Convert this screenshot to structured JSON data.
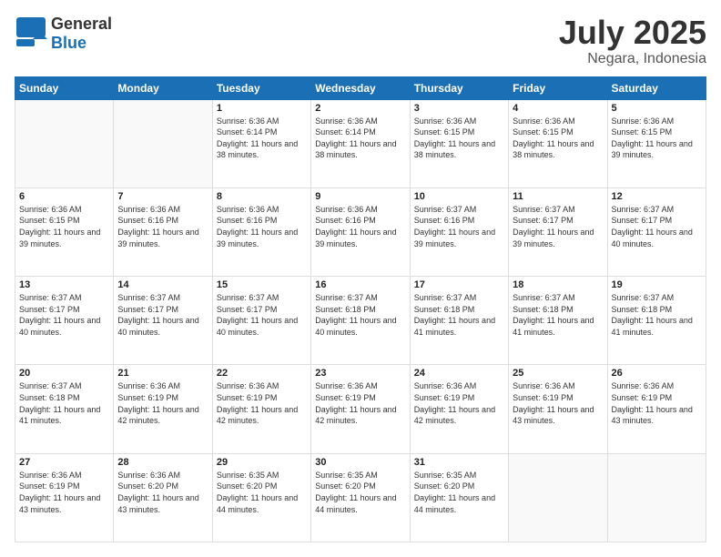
{
  "logo": {
    "general": "General",
    "blue": "Blue"
  },
  "header": {
    "title": "July 2025",
    "subtitle": "Negara, Indonesia"
  },
  "days_of_week": [
    "Sunday",
    "Monday",
    "Tuesday",
    "Wednesday",
    "Thursday",
    "Friday",
    "Saturday"
  ],
  "weeks": [
    [
      {
        "day": "",
        "info": ""
      },
      {
        "day": "",
        "info": ""
      },
      {
        "day": "1",
        "info": "Sunrise: 6:36 AM\nSunset: 6:14 PM\nDaylight: 11 hours and 38 minutes."
      },
      {
        "day": "2",
        "info": "Sunrise: 6:36 AM\nSunset: 6:14 PM\nDaylight: 11 hours and 38 minutes."
      },
      {
        "day": "3",
        "info": "Sunrise: 6:36 AM\nSunset: 6:15 PM\nDaylight: 11 hours and 38 minutes."
      },
      {
        "day": "4",
        "info": "Sunrise: 6:36 AM\nSunset: 6:15 PM\nDaylight: 11 hours and 38 minutes."
      },
      {
        "day": "5",
        "info": "Sunrise: 6:36 AM\nSunset: 6:15 PM\nDaylight: 11 hours and 39 minutes."
      }
    ],
    [
      {
        "day": "6",
        "info": "Sunrise: 6:36 AM\nSunset: 6:15 PM\nDaylight: 11 hours and 39 minutes."
      },
      {
        "day": "7",
        "info": "Sunrise: 6:36 AM\nSunset: 6:16 PM\nDaylight: 11 hours and 39 minutes."
      },
      {
        "day": "8",
        "info": "Sunrise: 6:36 AM\nSunset: 6:16 PM\nDaylight: 11 hours and 39 minutes."
      },
      {
        "day": "9",
        "info": "Sunrise: 6:36 AM\nSunset: 6:16 PM\nDaylight: 11 hours and 39 minutes."
      },
      {
        "day": "10",
        "info": "Sunrise: 6:37 AM\nSunset: 6:16 PM\nDaylight: 11 hours and 39 minutes."
      },
      {
        "day": "11",
        "info": "Sunrise: 6:37 AM\nSunset: 6:17 PM\nDaylight: 11 hours and 39 minutes."
      },
      {
        "day": "12",
        "info": "Sunrise: 6:37 AM\nSunset: 6:17 PM\nDaylight: 11 hours and 40 minutes."
      }
    ],
    [
      {
        "day": "13",
        "info": "Sunrise: 6:37 AM\nSunset: 6:17 PM\nDaylight: 11 hours and 40 minutes."
      },
      {
        "day": "14",
        "info": "Sunrise: 6:37 AM\nSunset: 6:17 PM\nDaylight: 11 hours and 40 minutes."
      },
      {
        "day": "15",
        "info": "Sunrise: 6:37 AM\nSunset: 6:17 PM\nDaylight: 11 hours and 40 minutes."
      },
      {
        "day": "16",
        "info": "Sunrise: 6:37 AM\nSunset: 6:18 PM\nDaylight: 11 hours and 40 minutes."
      },
      {
        "day": "17",
        "info": "Sunrise: 6:37 AM\nSunset: 6:18 PM\nDaylight: 11 hours and 41 minutes."
      },
      {
        "day": "18",
        "info": "Sunrise: 6:37 AM\nSunset: 6:18 PM\nDaylight: 11 hours and 41 minutes."
      },
      {
        "day": "19",
        "info": "Sunrise: 6:37 AM\nSunset: 6:18 PM\nDaylight: 11 hours and 41 minutes."
      }
    ],
    [
      {
        "day": "20",
        "info": "Sunrise: 6:37 AM\nSunset: 6:18 PM\nDaylight: 11 hours and 41 minutes."
      },
      {
        "day": "21",
        "info": "Sunrise: 6:36 AM\nSunset: 6:19 PM\nDaylight: 11 hours and 42 minutes."
      },
      {
        "day": "22",
        "info": "Sunrise: 6:36 AM\nSunset: 6:19 PM\nDaylight: 11 hours and 42 minutes."
      },
      {
        "day": "23",
        "info": "Sunrise: 6:36 AM\nSunset: 6:19 PM\nDaylight: 11 hours and 42 minutes."
      },
      {
        "day": "24",
        "info": "Sunrise: 6:36 AM\nSunset: 6:19 PM\nDaylight: 11 hours and 42 minutes."
      },
      {
        "day": "25",
        "info": "Sunrise: 6:36 AM\nSunset: 6:19 PM\nDaylight: 11 hours and 43 minutes."
      },
      {
        "day": "26",
        "info": "Sunrise: 6:36 AM\nSunset: 6:19 PM\nDaylight: 11 hours and 43 minutes."
      }
    ],
    [
      {
        "day": "27",
        "info": "Sunrise: 6:36 AM\nSunset: 6:19 PM\nDaylight: 11 hours and 43 minutes."
      },
      {
        "day": "28",
        "info": "Sunrise: 6:36 AM\nSunset: 6:20 PM\nDaylight: 11 hours and 43 minutes."
      },
      {
        "day": "29",
        "info": "Sunrise: 6:35 AM\nSunset: 6:20 PM\nDaylight: 11 hours and 44 minutes."
      },
      {
        "day": "30",
        "info": "Sunrise: 6:35 AM\nSunset: 6:20 PM\nDaylight: 11 hours and 44 minutes."
      },
      {
        "day": "31",
        "info": "Sunrise: 6:35 AM\nSunset: 6:20 PM\nDaylight: 11 hours and 44 minutes."
      },
      {
        "day": "",
        "info": ""
      },
      {
        "day": "",
        "info": ""
      }
    ]
  ]
}
